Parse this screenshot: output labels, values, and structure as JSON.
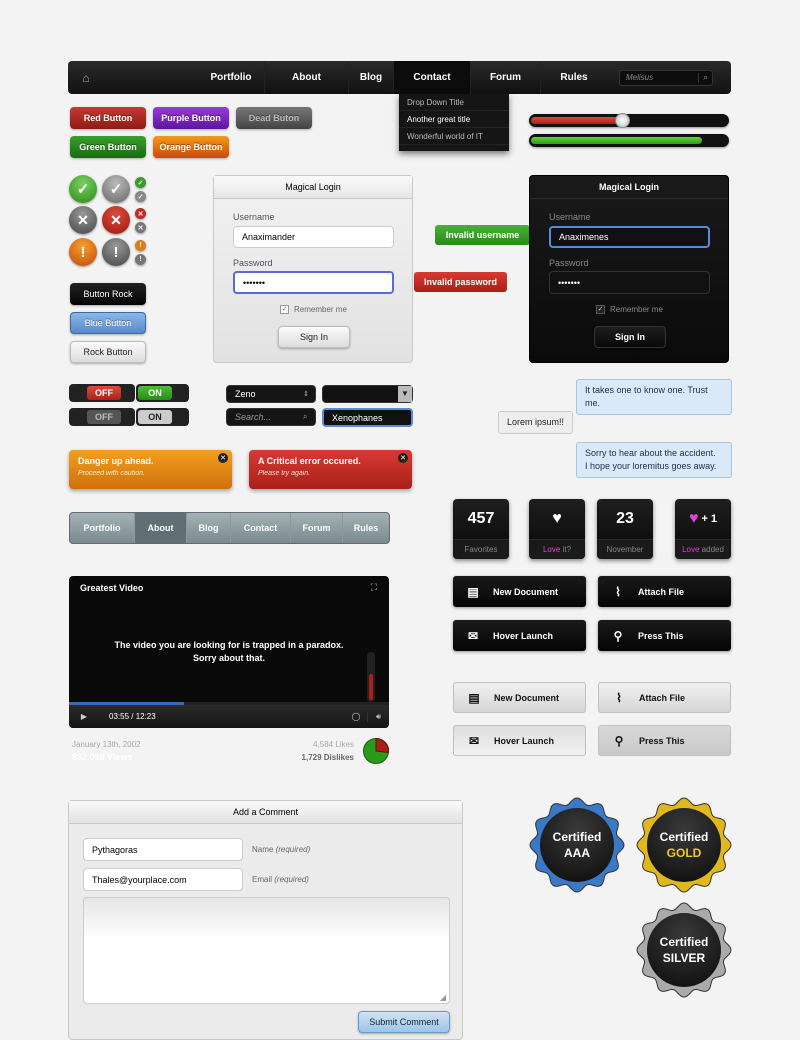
{
  "topnav": {
    "items": [
      "Portfolio",
      "About",
      "Blog",
      "Contact",
      "Forum",
      "Rules"
    ],
    "active": "Contact",
    "search_placeholder": "Melisus",
    "dropdown": [
      "Drop Down Title",
      "Another great title",
      "Wonderful world of IT"
    ]
  },
  "buttons": {
    "red": "Red Button",
    "purple": "Purple Button",
    "dead": "Dead Buton",
    "green": "Green Button",
    "orange": "Orange Button",
    "rock": "Button Rock",
    "blue": "Blue Button",
    "rock_light": "Rock Button"
  },
  "sliders": {
    "red_value": 0.47,
    "green_value": 0.87
  },
  "login_light": {
    "title": "Magical Login",
    "username_label": "Username",
    "username": "Anaximander",
    "password_label": "Password",
    "password": "•••••••",
    "remember": "Remember me",
    "signin": "Sign In"
  },
  "login_dark": {
    "title": "Magical Login",
    "username_label": "Username",
    "username": "Anaximenes",
    "password_label": "Password",
    "password": "•••••••",
    "remember": "Remember me",
    "signin": "Sign In"
  },
  "validation": {
    "username": "Invalid username",
    "password": "Invalid password"
  },
  "toggles": {
    "off": "OFF",
    "on": "ON"
  },
  "selects": {
    "zeno": "Zeno",
    "search_placeholder": "Search...",
    "xeno": "Xenophanes"
  },
  "bubbles": [
    "It takes one to know one. Trust me.",
    "Lorem ipsum!!",
    "Sorry to hear about the accident.",
    "I hope your loremitus goes away."
  ],
  "alerts": [
    {
      "title": "Danger up ahead.",
      "text": "Proceed with caution."
    },
    {
      "title": "A Critical error occured.",
      "text": "Please try again."
    }
  ],
  "lightnav": {
    "items": [
      "Portfolio",
      "About",
      "Blog",
      "Contact",
      "Forum",
      "Rules"
    ],
    "active": "About"
  },
  "stats": {
    "favorites_num": "457",
    "favorites_label": "Favorites",
    "love_word": "Love",
    "love_suffix": "it?",
    "day": "23",
    "month": "November",
    "plus": "+ 1",
    "love_added": "added"
  },
  "actions": {
    "new_doc": "New Document",
    "attach": "Attach File",
    "hover": "Hover Launch",
    "press": "Press This"
  },
  "video": {
    "title": "Greatest Video",
    "message1": "The video you are looking for is trapped in a paradox.",
    "message2": "Sorry about that.",
    "time": "03:55 / 12:23",
    "progress": 0.36,
    "date": "January 13th, 2002",
    "views": "832,098 Views",
    "likes": "4,584 Likes",
    "dislikes": "1,729 Dislikes",
    "like_ratio": 0.73
  },
  "comment": {
    "title": "Add a Comment",
    "name": "Pythagoras",
    "name_label": "Name",
    "email": "Thales@yourplace.com",
    "email_label": "Email",
    "required": "(required)",
    "submit": "Submit Comment"
  },
  "badges": [
    {
      "line1": "Certified",
      "line2": "AAA",
      "color": "#3a78c8"
    },
    {
      "line1": "Certified",
      "line2": "GOLD",
      "color": "#e0b81c"
    },
    {
      "line1": "Certified",
      "line2": "SILVER",
      "color": "#aaaaaa"
    }
  ]
}
